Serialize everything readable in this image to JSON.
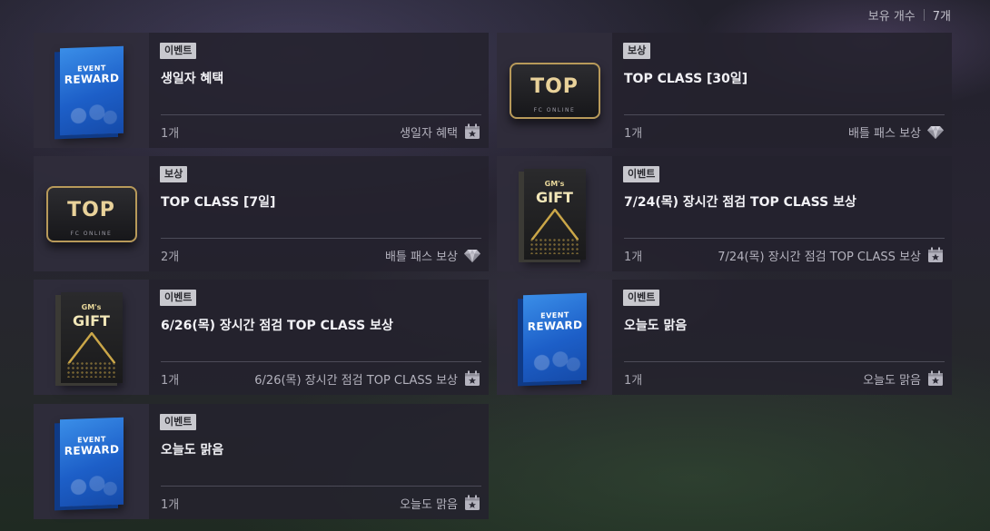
{
  "header": {
    "owned_label": "보유 개수",
    "owned_count": "7개"
  },
  "items": [
    {
      "badge": "이벤트",
      "title": "생일자 혜택",
      "quantity": "1개",
      "source": "생일자 혜택",
      "source_icon": "calendar-star-icon",
      "art": "event-reward-box",
      "art_text": [
        "EVENT",
        "REWARD"
      ]
    },
    {
      "badge": "보상",
      "title": "TOP CLASS [30일]",
      "quantity": "1개",
      "source": "배틀 패스 보상",
      "source_icon": "diamond-icon",
      "art": "top-class-card",
      "art_text": [
        "TOP",
        "FC ONLINE"
      ]
    },
    {
      "badge": "보상",
      "title": "TOP CLASS [7일]",
      "quantity": "2개",
      "source": "배틀 패스 보상",
      "source_icon": "diamond-icon",
      "art": "top-class-card",
      "art_text": [
        "TOP",
        "FC ONLINE"
      ]
    },
    {
      "badge": "이벤트",
      "title": "7/24(목) 장시간 점검 TOP CLASS 보상",
      "quantity": "1개",
      "source": "7/24(목) 장시간 점검 TOP CLASS 보상",
      "source_icon": "calendar-star-icon",
      "art": "gms-gift-box",
      "art_text": [
        "GM's",
        "GIFT"
      ]
    },
    {
      "badge": "이벤트",
      "title": "6/26(목) 장시간 점검 TOP CLASS 보상",
      "quantity": "1개",
      "source": "6/26(목) 장시간 점검 TOP CLASS 보상",
      "source_icon": "calendar-star-icon",
      "art": "gms-gift-box",
      "art_text": [
        "GM's",
        "GIFT"
      ]
    },
    {
      "badge": "이벤트",
      "title": "오늘도 맑음",
      "quantity": "1개",
      "source": "오늘도 맑음",
      "source_icon": "calendar-star-icon",
      "art": "event-reward-box",
      "art_text": [
        "EVENT",
        "REWARD"
      ]
    },
    {
      "badge": "이벤트",
      "title": "오늘도 맑음",
      "quantity": "1개",
      "source": "오늘도 맑음",
      "source_icon": "calendar-star-icon",
      "art": "event-reward-box",
      "art_text": [
        "EVENT",
        "REWARD"
      ]
    }
  ],
  "colors": {
    "badge_bg": "#c8c8ce",
    "card_bg": "#24222e",
    "text_primary": "#f2f2f6",
    "text_muted": "#a9a8b3",
    "gold": "#caa648"
  }
}
